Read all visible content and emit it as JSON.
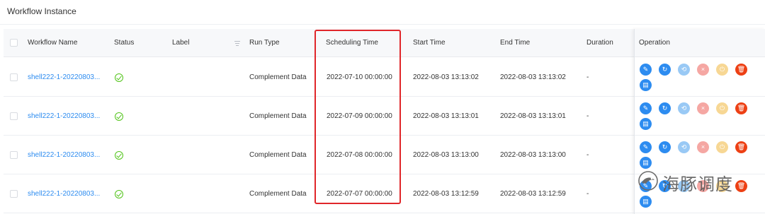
{
  "page": {
    "title": "Workflow Instance"
  },
  "table": {
    "columns": {
      "workflow_name": "Workflow Name",
      "status": "Status",
      "label": "Label",
      "run_type": "Run Type",
      "scheduling_time": "Scheduling Time",
      "start_time": "Start Time",
      "end_time": "End Time",
      "duration": "Duration",
      "operation": "Operation"
    },
    "rows": [
      {
        "name": "shell222-1-20220803...",
        "status": "success",
        "label": "",
        "run_type": "Complement Data",
        "scheduling_time": "2022-07-10 00:00:00",
        "start_time": "2022-08-03 13:13:02",
        "end_time": "2022-08-03 13:13:02",
        "duration": "-"
      },
      {
        "name": "shell222-1-20220803...",
        "status": "success",
        "label": "",
        "run_type": "Complement Data",
        "scheduling_time": "2022-07-09 00:00:00",
        "start_time": "2022-08-03 13:13:01",
        "end_time": "2022-08-03 13:13:01",
        "duration": "-"
      },
      {
        "name": "shell222-1-20220803...",
        "status": "success",
        "label": "",
        "run_type": "Complement Data",
        "scheduling_time": "2022-07-08 00:00:00",
        "start_time": "2022-08-03 13:13:00",
        "end_time": "2022-08-03 13:13:00",
        "duration": "-"
      },
      {
        "name": "shell222-1-20220803...",
        "status": "success",
        "label": "",
        "run_type": "Complement Data",
        "scheduling_time": "2022-07-07 00:00:00",
        "start_time": "2022-08-03 13:12:59",
        "end_time": "2022-08-03 13:12:59",
        "duration": "-"
      }
    ]
  },
  "operations": [
    {
      "icon": "edit-icon",
      "color": "#2d8cf0",
      "glyph": "✎"
    },
    {
      "icon": "rerun-icon",
      "color": "#2d8cf0",
      "glyph": "↻"
    },
    {
      "icon": "recover-icon",
      "color": "#99c9f5",
      "glyph": "⟲"
    },
    {
      "icon": "stop-icon",
      "color": "#f5a7a3",
      "glyph": "×"
    },
    {
      "icon": "pause-icon",
      "color": "#f7d794",
      "glyph": "⏻"
    },
    {
      "icon": "delete-icon",
      "color": "#ed4014",
      "glyph": "🗑"
    },
    {
      "icon": "gantt-icon",
      "color": "#2d8cf0",
      "glyph": "▤"
    }
  ],
  "watermark": {
    "text": "海豚调度"
  },
  "colors": {
    "link": "#2d8cf0",
    "success": "#52c41a",
    "highlight": "#e0262a"
  }
}
